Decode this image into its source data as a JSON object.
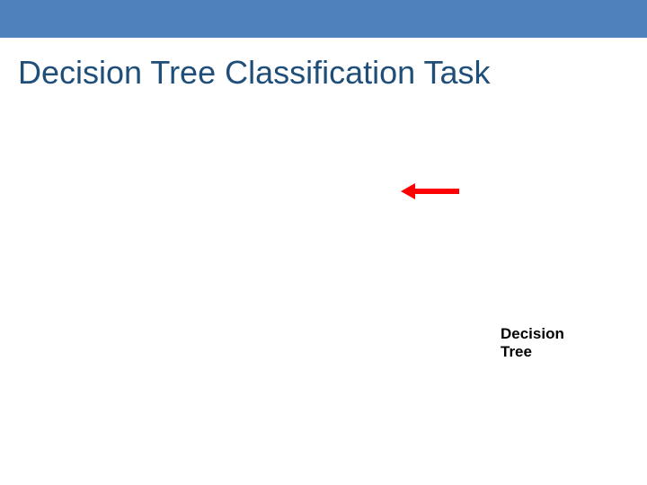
{
  "slide": {
    "title": "Decision Tree Classification Task",
    "label_line1": "Decision",
    "label_line2": "Tree"
  },
  "colors": {
    "top_bar": "#4f81bd",
    "title_text": "#1f4e79",
    "arrow": "#ff0000"
  }
}
